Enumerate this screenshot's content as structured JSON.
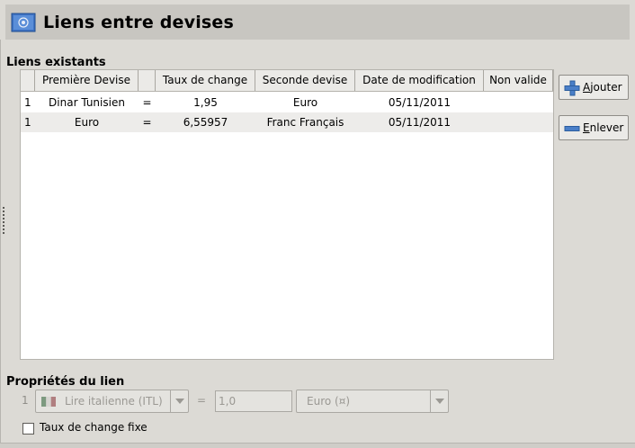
{
  "header": {
    "title": "Liens entre devises",
    "icon": "currency-flag-icon"
  },
  "existing": {
    "label": "Liens existants",
    "columns": [
      "",
      "Première Devise",
      "",
      "Taux de change",
      "Seconde devise",
      "Date de modification",
      "Non valide"
    ],
    "rows": [
      {
        "qty": "1",
        "first": "Dinar Tunisien",
        "op": "=",
        "rate": "1,95",
        "second": "Euro",
        "date": "05/11/2011",
        "invalid": ""
      },
      {
        "qty": "1",
        "first": "Euro",
        "op": "=",
        "rate": "6,55957",
        "second": "Franc Français",
        "date": "05/11/2011",
        "invalid": ""
      }
    ]
  },
  "buttons": {
    "add_label": "Ajouter",
    "remove_label": "Enlever",
    "add_icon": "plus-icon",
    "remove_icon": "minus-icon"
  },
  "properties": {
    "label": "Propriétés du lien",
    "index": "1",
    "first_currency": "Lire italienne (ITL)",
    "equals": "=",
    "rate": "1,0",
    "second_currency": "Euro (¤)",
    "fixed_rate_label": "Taux de change fixe",
    "fixed_rate_checked": false
  },
  "colors": {
    "background": "#dcdad5",
    "header": "#c8c6c1",
    "alt_row": "#edecea"
  }
}
